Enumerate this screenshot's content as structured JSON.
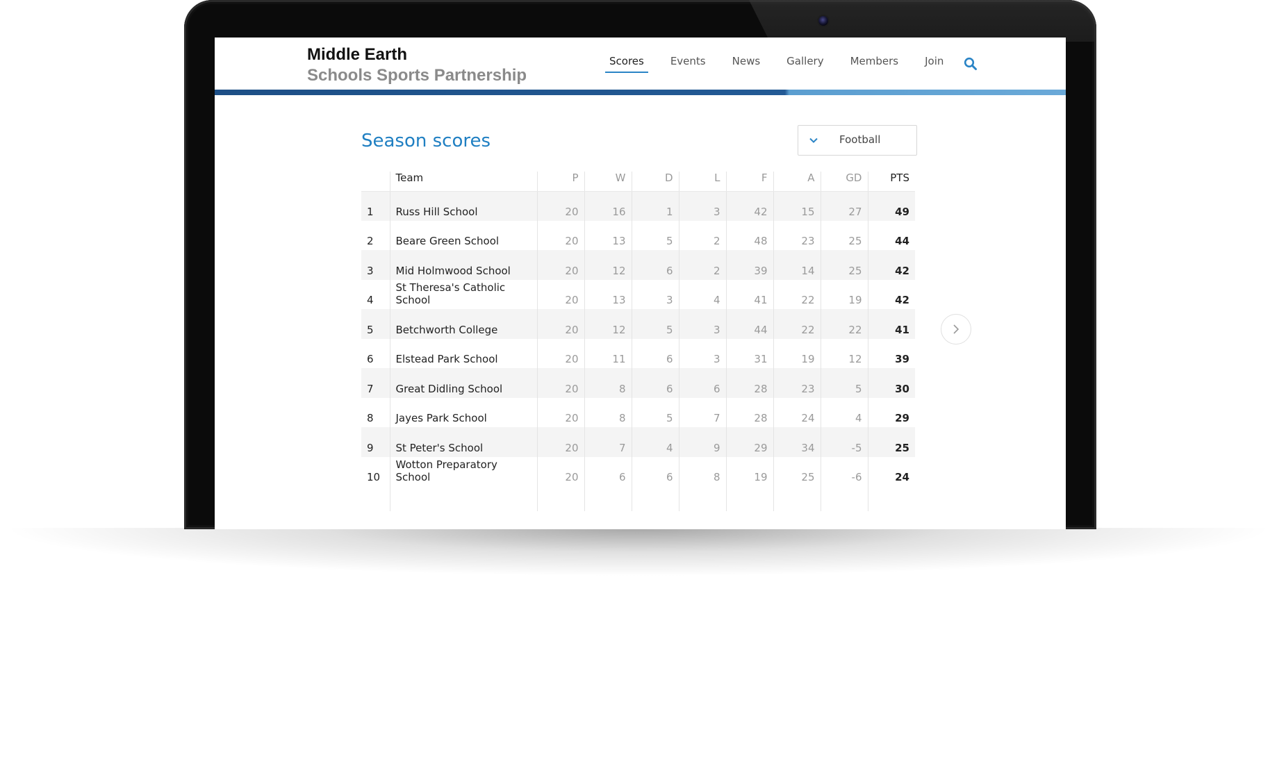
{
  "header": {
    "brand_line1": "Middle Earth",
    "brand_line2": "Schools Sports Partnership",
    "nav": [
      {
        "label": "Scores",
        "active": true
      },
      {
        "label": "Events",
        "active": false
      },
      {
        "label": "News",
        "active": false
      },
      {
        "label": "Gallery",
        "active": false
      },
      {
        "label": "Members",
        "active": false
      },
      {
        "label": "Join",
        "active": false
      }
    ],
    "search_icon": "search-icon"
  },
  "main": {
    "title": "Season scores",
    "sport_select": {
      "value": "Football",
      "icon": "chevron-down-icon"
    },
    "next_icon": "chevron-right-icon"
  },
  "table": {
    "columns": [
      "",
      "Team",
      "P",
      "W",
      "D",
      "L",
      "F",
      "A",
      "GD",
      "PTS"
    ],
    "rows": [
      {
        "pos": "1",
        "team": "Russ Hill School",
        "p": "20",
        "w": "16",
        "d": "1",
        "l": "3",
        "f": "42",
        "a": "15",
        "gd": "27",
        "pts": "49"
      },
      {
        "pos": "2",
        "team": "Beare Green School",
        "p": "20",
        "w": "13",
        "d": "5",
        "l": "2",
        "f": "48",
        "a": "23",
        "gd": "25",
        "pts": "44"
      },
      {
        "pos": "3",
        "team": "Mid Holmwood School",
        "p": "20",
        "w": "12",
        "d": "6",
        "l": "2",
        "f": "39",
        "a": "14",
        "gd": "25",
        "pts": "42"
      },
      {
        "pos": "4",
        "team": "St Theresa's Catholic School",
        "p": "20",
        "w": "13",
        "d": "3",
        "l": "4",
        "f": "41",
        "a": "22",
        "gd": "19",
        "pts": "42"
      },
      {
        "pos": "5",
        "team": "Betchworth College",
        "p": "20",
        "w": "12",
        "d": "5",
        "l": "3",
        "f": "44",
        "a": "22",
        "gd": "22",
        "pts": "41"
      },
      {
        "pos": "6",
        "team": "Elstead Park School",
        "p": "20",
        "w": "11",
        "d": "6",
        "l": "3",
        "f": "31",
        "a": "19",
        "gd": "12",
        "pts": "39"
      },
      {
        "pos": "7",
        "team": "Great Didling School",
        "p": "20",
        "w": "8",
        "d": "6",
        "l": "6",
        "f": "28",
        "a": "23",
        "gd": "5",
        "pts": "30"
      },
      {
        "pos": "8",
        "team": "Jayes Park School",
        "p": "20",
        "w": "8",
        "d": "5",
        "l": "7",
        "f": "28",
        "a": "24",
        "gd": "4",
        "pts": "29"
      },
      {
        "pos": "9",
        "team": "St Peter's School",
        "p": "20",
        "w": "7",
        "d": "4",
        "l": "9",
        "f": "29",
        "a": "34",
        "gd": "-5",
        "pts": "25"
      },
      {
        "pos": "10",
        "team": "Wotton Preparatory School",
        "p": "20",
        "w": "6",
        "d": "6",
        "l": "8",
        "f": "19",
        "a": "25",
        "gd": "-6",
        "pts": "24"
      }
    ]
  }
}
